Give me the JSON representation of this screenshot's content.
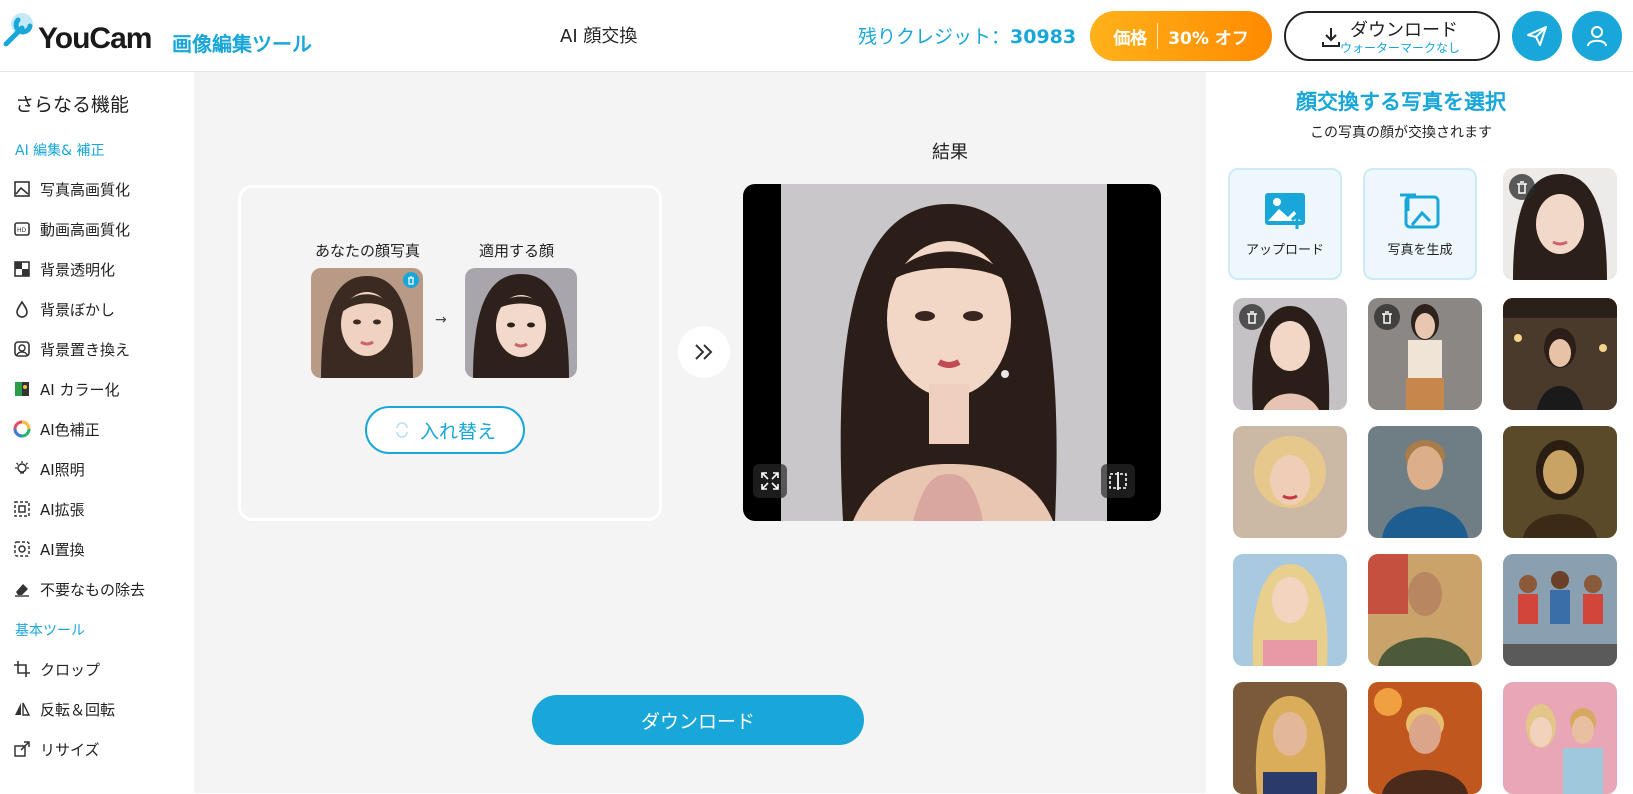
{
  "header": {
    "logo_text": "YouCam",
    "logo_sub": "画像編集ツール",
    "page_title": "AI 顔交換",
    "credits_label": "残りクレジット：",
    "credits_value": "30983",
    "price_label": "価格",
    "price_discount": "30% オフ",
    "download_label": "ダウンロード",
    "download_sub": "ウォーターマークなし"
  },
  "sidebar": {
    "title": "さらなる機能",
    "section1": "AI 編集& 補正",
    "items1": [
      "写真高画質化",
      "動画高画質化",
      "背景透明化",
      "背景ぼかし",
      "背景置き換え",
      "AI カラー化",
      "AI色補正",
      "AI照明",
      "AI拡張",
      "AI置換",
      "不要なもの除去"
    ],
    "section2": "基本ツール",
    "items2": [
      "クロップ",
      "反転＆回転",
      "リサイズ"
    ]
  },
  "main": {
    "your_face_label": "あなたの顔写真",
    "apply_face_label": "適用する顔",
    "swap_label": "入れ替え",
    "result_label": "結果",
    "download_label": "ダウンロード"
  },
  "right": {
    "title": "顔交換する写真を選択",
    "subtitle": "この写真の顔が交換されます",
    "upload_label": "アップロード",
    "generate_label": "写真を生成"
  },
  "colors": {
    "accent": "#18a7d8",
    "orange": "#ff9500"
  }
}
